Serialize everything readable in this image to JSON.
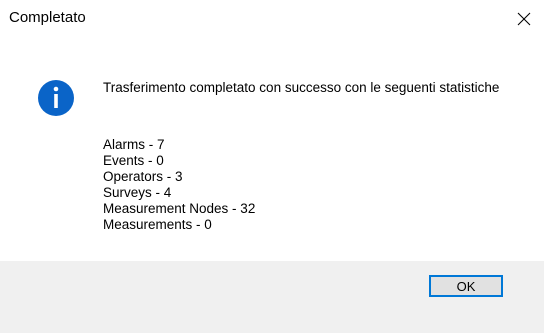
{
  "window": {
    "title": "Completato"
  },
  "message": {
    "text": "Trasferimento completato con successo con le seguenti statistiche",
    "icon": "info-icon"
  },
  "stats": [
    "Alarms - 7",
    "Events - 0",
    "Operators - 3",
    "Surveys - 4",
    "Measurement Nodes - 32",
    "Measurements - 0"
  ],
  "footer": {
    "ok_label": "OK"
  },
  "colors": {
    "icon_blue": "#0a64c8",
    "button_border": "#0078d7",
    "footer_bg": "#f0f0f0"
  }
}
